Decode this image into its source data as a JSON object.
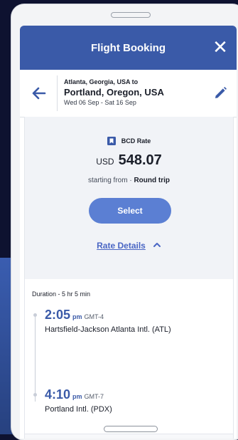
{
  "header": {
    "title": "Flight Booking"
  },
  "route": {
    "from": "Atlanta, Georgia, USA to",
    "to": "Portland, Oregon, USA",
    "dates": "Wed 06 Sep - Sat 16 Sep"
  },
  "rate": {
    "name": "BCD Rate",
    "currency": "USD",
    "amount": "548.07",
    "starting_prefix": "starting from · ",
    "trip_type": "Round trip",
    "select_label": "Select",
    "details_label": "Rate Details"
  },
  "itinerary": {
    "duration": "Duration - 5 hr 5 min",
    "segments": [
      {
        "time": "2:05",
        "ampm": "pm",
        "tz": "GMT-4",
        "airport": "Hartsfield-Jackson Atlanta Intl. (ATL)"
      },
      {
        "time": "4:10",
        "ampm": "pm",
        "tz": "GMT-7",
        "airport": "Portland Intl. (PDX)"
      }
    ]
  },
  "colors": {
    "header": "#3a5aa8",
    "accent": "#5b7fd3",
    "link": "#4a66c4",
    "time": "#3a5aa8"
  },
  "icons": {
    "close": "close-icon",
    "back": "arrow-left-icon",
    "edit": "pencil-icon",
    "rate": "bookmark-icon",
    "caret": "chevron-up-icon"
  }
}
